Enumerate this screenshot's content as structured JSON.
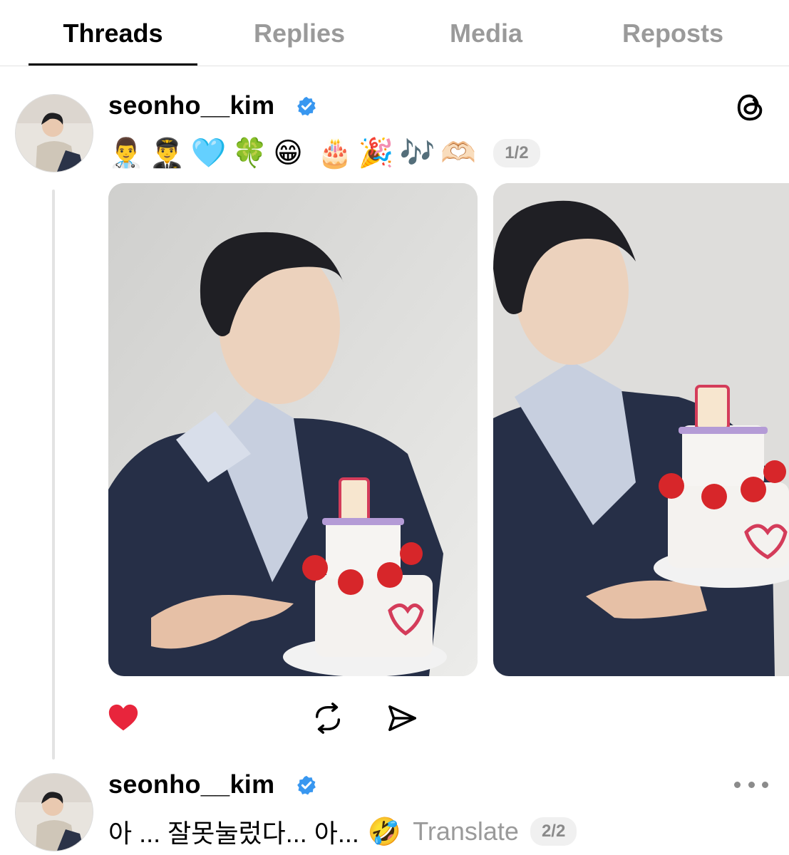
{
  "tabs": [
    {
      "label": "Threads",
      "active": true
    },
    {
      "label": "Replies",
      "active": false
    },
    {
      "label": "Media",
      "active": false
    },
    {
      "label": "Reposts",
      "active": false
    }
  ],
  "post1": {
    "username": "seonho__kim",
    "emojis": [
      "👨‍⚕️",
      "👨‍✈️",
      "🩵",
      "🍀",
      "😁",
      "🎂",
      "🎉",
      "🎶",
      "🫶🏻"
    ],
    "counter": "1/2",
    "images": [
      "photo-cake-pointing",
      "photo-cake-holding"
    ],
    "liked": true
  },
  "post2": {
    "username": "seonho__kim",
    "text": "아 ... 잘못눌렀다... 아...",
    "emoji": "🤣",
    "translate_label": "Translate",
    "counter": "2/2"
  },
  "colors": {
    "like_red": "#e8253c",
    "verified_blue": "#3897f0",
    "muted": "#9a9a9a"
  }
}
